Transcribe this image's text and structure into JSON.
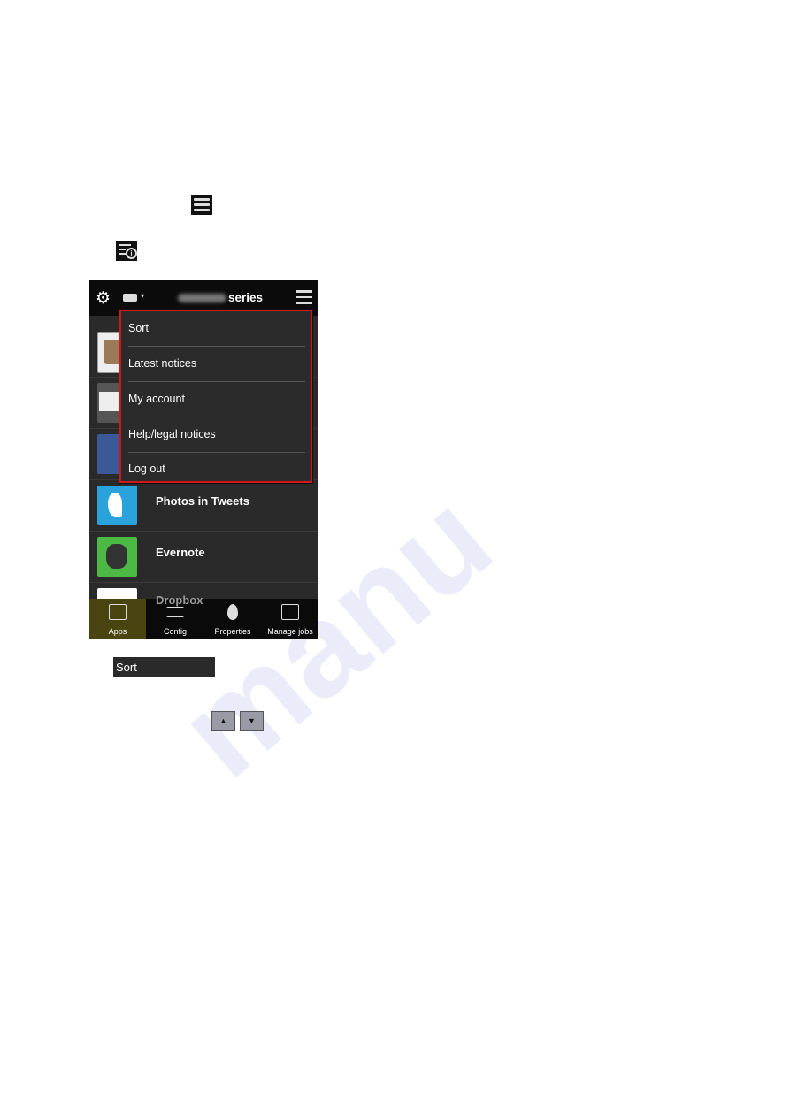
{
  "watermark": "manu",
  "inline_icons": [
    "menu-icon",
    "notices-info-icon"
  ],
  "app": {
    "header": {
      "title_suffix": "series",
      "icons": [
        "gear-icon",
        "printer-icon",
        "menu-icon"
      ]
    },
    "apps": [
      {
        "label": "",
        "icon": "instagram-icon"
      },
      {
        "label": "",
        "icon": "mail-icon"
      },
      {
        "label": "",
        "icon": "facebook-icon"
      },
      {
        "label": "Photos in Tweets",
        "icon": "photos-in-tweets-icon"
      },
      {
        "label": "Evernote",
        "icon": "evernote-icon"
      },
      {
        "label": "Dropbox",
        "icon": "dropbox-icon"
      }
    ],
    "menu": [
      "Sort",
      "Latest notices",
      "My account",
      "Help/legal notices",
      "Log out"
    ],
    "tabs": [
      {
        "label": "Apps",
        "active": true
      },
      {
        "label": "Config"
      },
      {
        "label": "Properties"
      },
      {
        "label": "Manage jobs"
      }
    ],
    "highlight_color": "#d01818"
  },
  "sort_button": "Sort",
  "arrows": {
    "up": "▲",
    "down": "▼"
  }
}
